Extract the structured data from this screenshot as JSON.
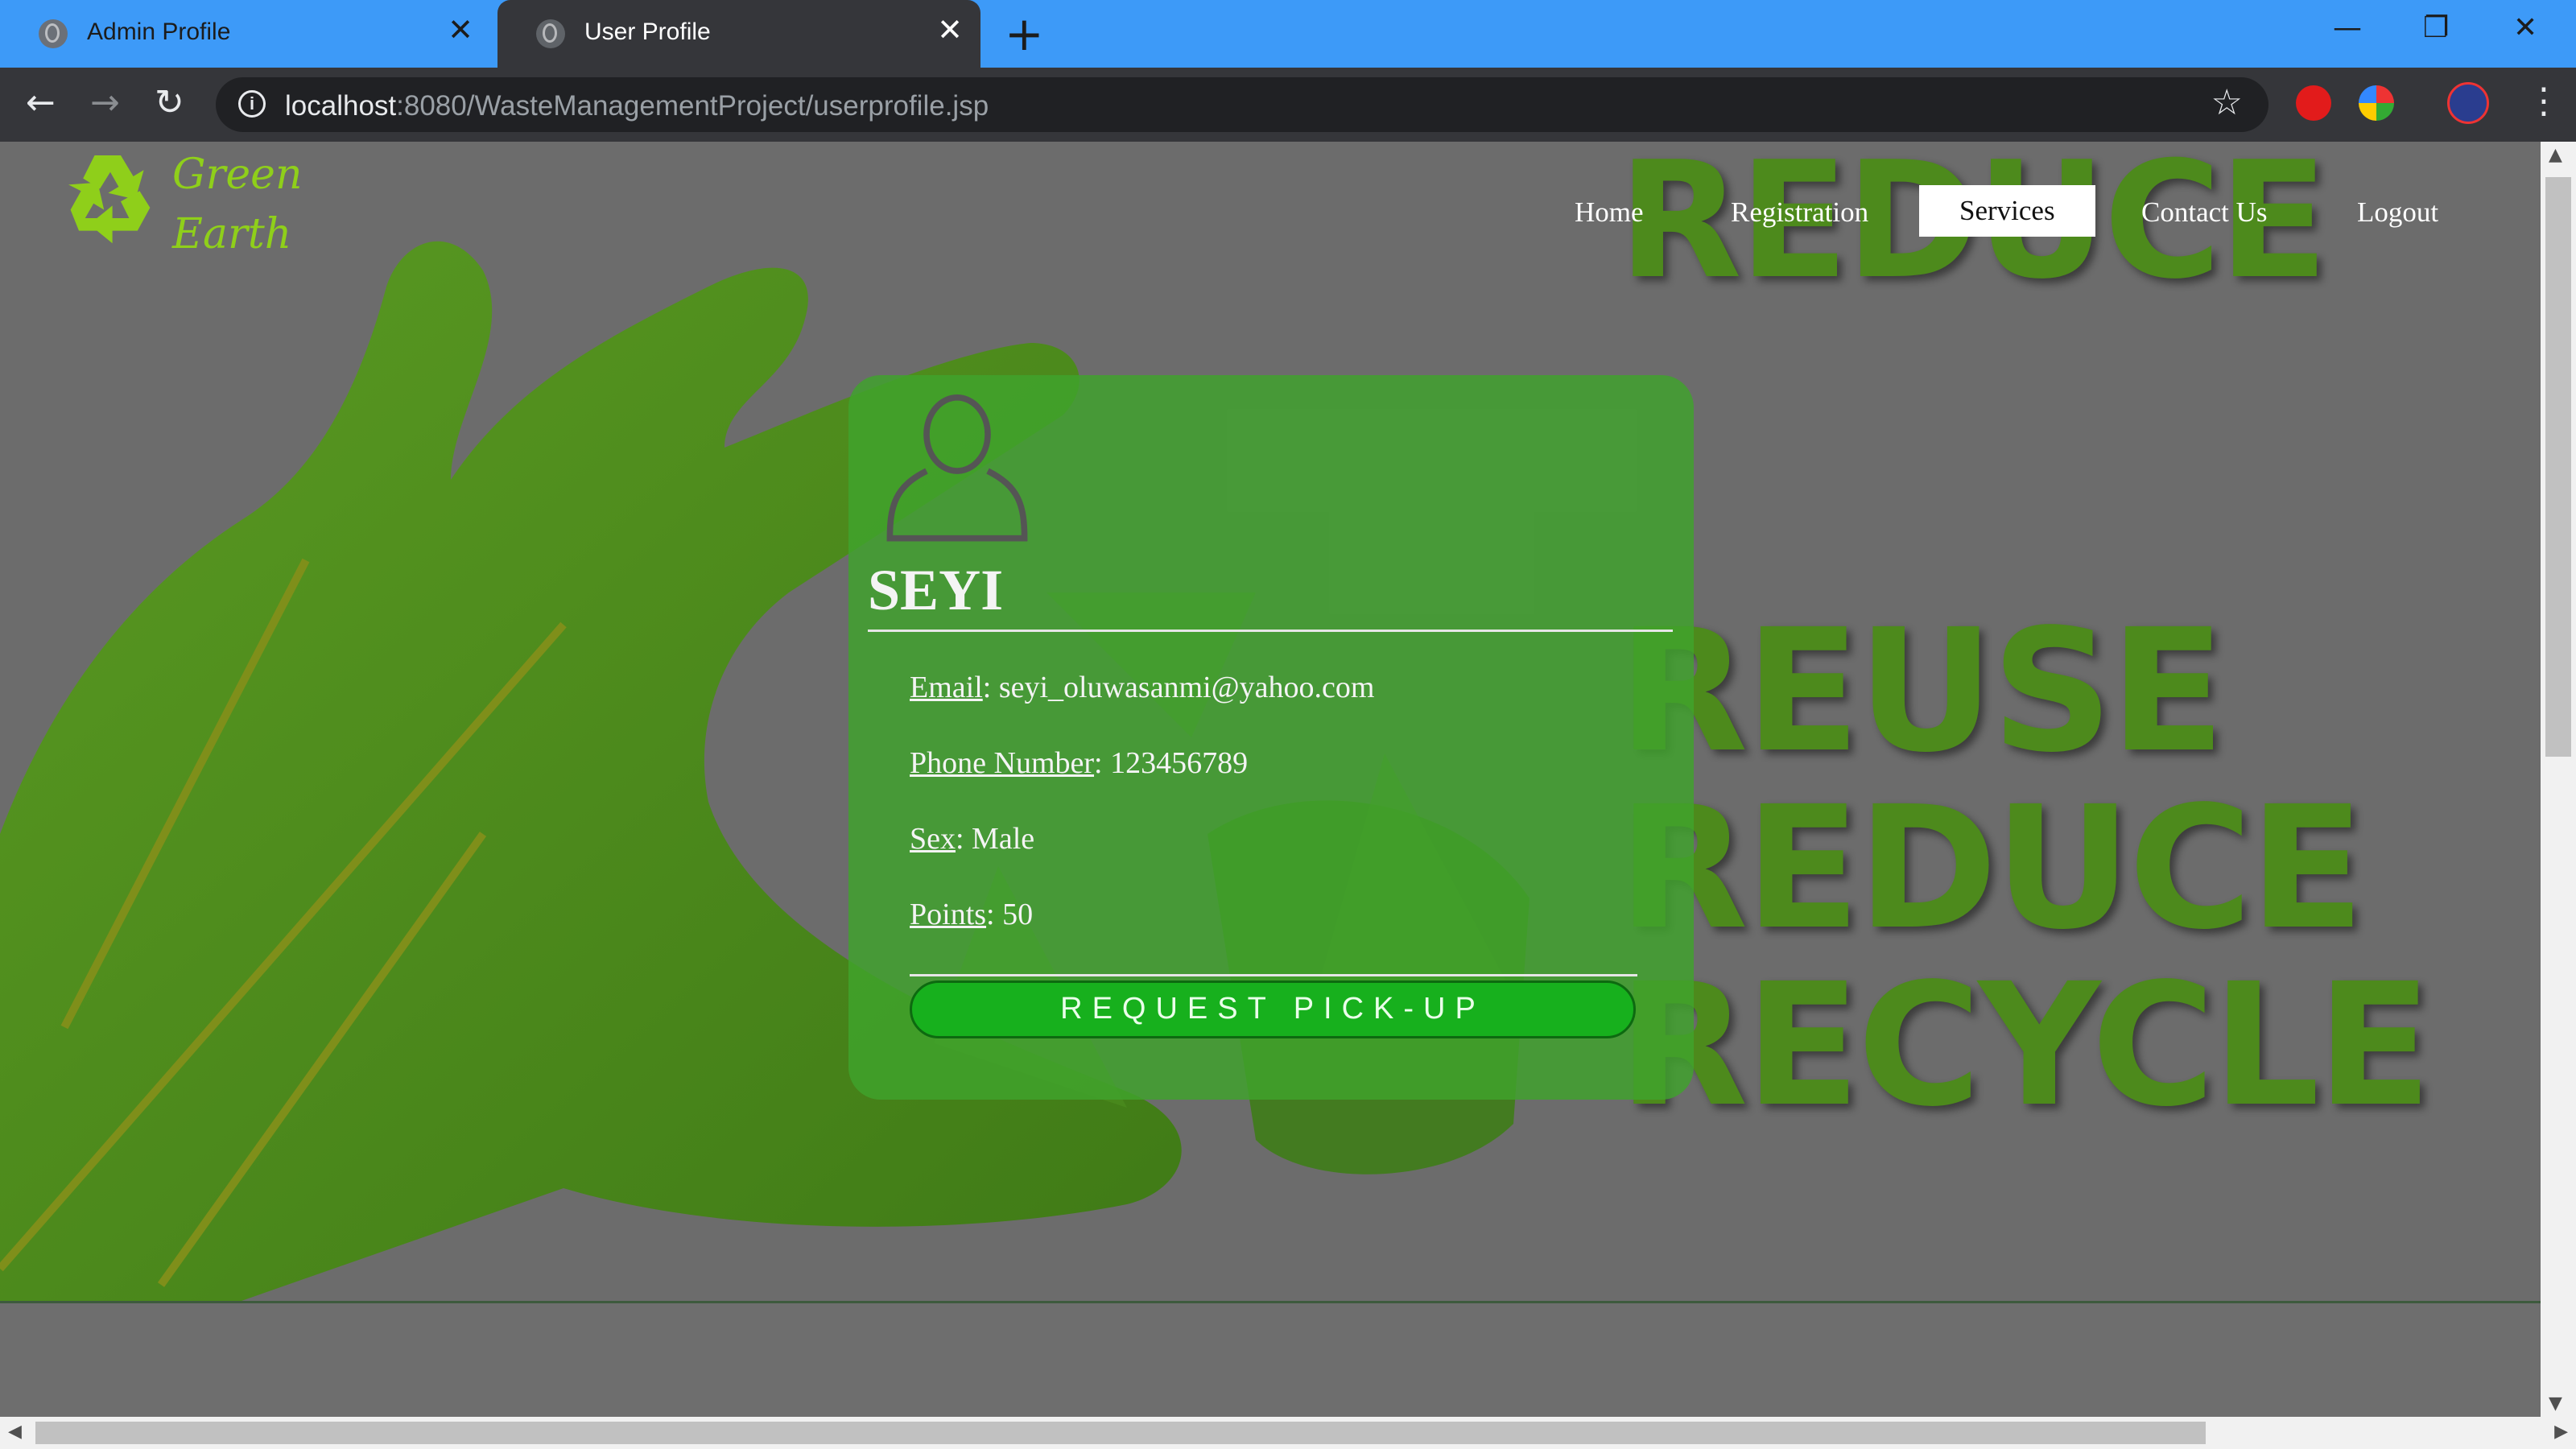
{
  "browser": {
    "tabs": [
      {
        "title": "Admin Profile",
        "active": false
      },
      {
        "title": "User Profile",
        "active": true
      }
    ],
    "new_tab_label": "+",
    "url_host": "localhost",
    "url_path": ":8080/WasteManagementProject/userprofile.jsp"
  },
  "site": {
    "logo_line1": "Green",
    "logo_line2": "Earth",
    "nav": [
      "Home",
      "Registration",
      "Services",
      "Contact Us",
      "Logout"
    ],
    "active_nav": "Services",
    "background_words": [
      "REDUCE",
      "REUSE",
      "REDUCE",
      "RECYCLE"
    ]
  },
  "profile": {
    "name": "SEYI",
    "fields": [
      {
        "label": "Email",
        "value": ": seyi_oluwasanmi@yahoo.com"
      },
      {
        "label": "Phone Number",
        "value": ": 123456789"
      },
      {
        "label": "Sex",
        "value": ": Male"
      },
      {
        "label": "Points",
        "value": ": 50"
      }
    ],
    "button_label": "REQUEST PICK-UP"
  },
  "colors": {
    "card": "#40a42c",
    "button": "#17b01d",
    "tabbar": "#3d9af8",
    "toolbar": "#35363a"
  }
}
